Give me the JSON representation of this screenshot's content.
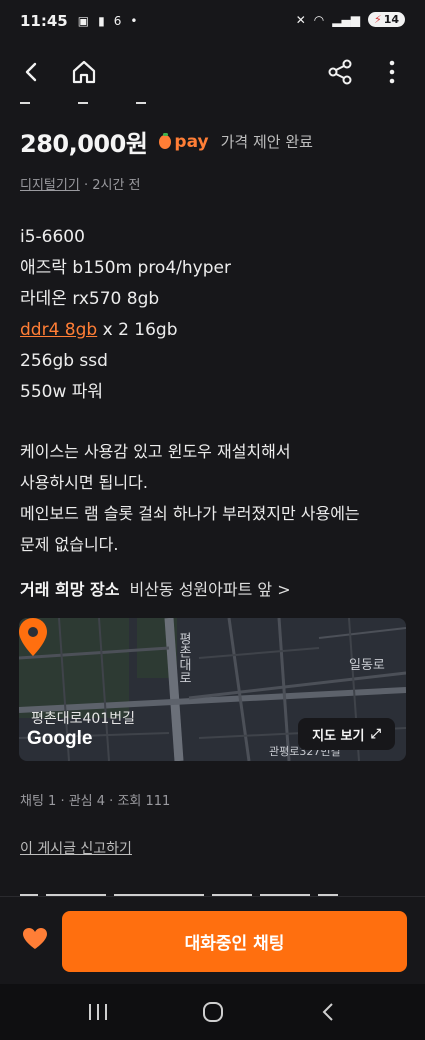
{
  "status_bar": {
    "time": "11:45",
    "battery": "14",
    "icons": [
      "gallery-icon",
      "lock-icon",
      "notification-6-icon",
      "dot-icon",
      "mute-icon",
      "wifi-icon",
      "signal-icon"
    ]
  },
  "header": {
    "icons": [
      "back-icon",
      "home-icon",
      "share-icon",
      "more-icon"
    ]
  },
  "listing": {
    "price": "280,000원",
    "pay_label": "pay",
    "offer_status": "가격 제안 완료",
    "category": "디지털기기",
    "posted": " · 2시간 전",
    "specs": {
      "line1": "i5-6600",
      "line2": "애즈락 b150m pro4/hyper",
      "line3": "라데온 rx570 8gb",
      "line4_link": "ddr4 8gb",
      "line4_rest": " x 2 16gb",
      "line5": "256gb ssd",
      "line6": "550w 파워"
    },
    "description": {
      "line1": "케이스는 사용감 있고 윈도우 재설치해서",
      "line2": "사용하시면 됩니다.",
      "line3": "메인보드 램 슬롯 걸쇠 하나가 부러졌지만 사용에는",
      "line4": "문제 없습니다."
    },
    "place_label": "거래 희망 장소",
    "place_value": "비산동 성원아파트 앞 >",
    "stats": "채팅 1 · 관심 4 · 조회 111",
    "report": "이 게시글 신고하기"
  },
  "map": {
    "labels": {
      "road1": "평촌대로",
      "road2": "평촌대로401번길",
      "road3": "일동로",
      "road4": "관평로327번길"
    },
    "google": "Google",
    "view_map": "지도 보기"
  },
  "bottom": {
    "chat_button": "대화중인 채팅"
  },
  "colors": {
    "accent": "#ff6f0f",
    "background": "#17171a"
  }
}
